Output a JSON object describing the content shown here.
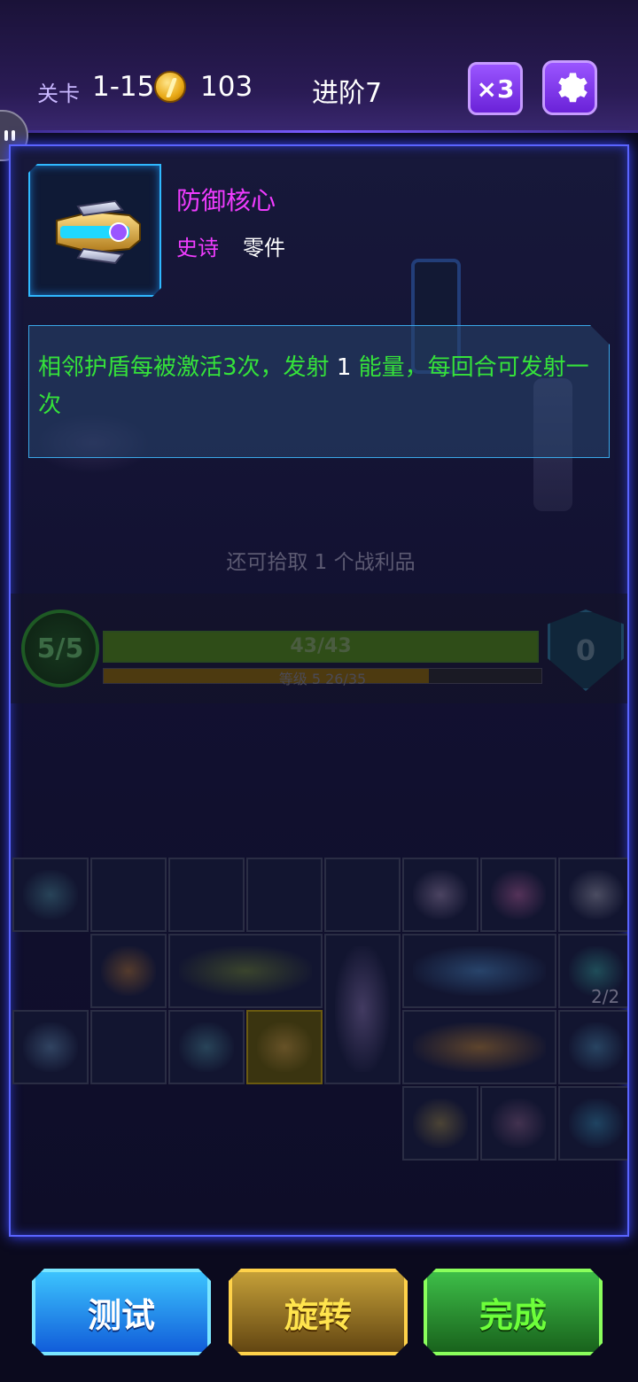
{
  "header": {
    "level_label": "关卡",
    "level_value": "1-15",
    "coins": "103",
    "stage": "进阶7",
    "multiplier": "×3"
  },
  "item": {
    "name": "防御核心",
    "rarity": "史诗",
    "type": "零件",
    "description_part1": "相邻护盾每被激活3次，发射 ",
    "description_num": "1",
    "description_part2": " 能量，每回合可发射一次"
  },
  "loot_text": "还可拾取 1 个战利品",
  "stats": {
    "hp_circle": "5/5",
    "hp_bar": "43/43",
    "hp_fraction": 1.0,
    "xp_text": "等级 5  26/35",
    "xp_fraction": 0.743,
    "shield": "0"
  },
  "grid_counter": "2/2",
  "buttons": {
    "test": "测试",
    "rotate": "旋转",
    "done": "完成"
  },
  "colors": {
    "accent_purple": "#9a55ff",
    "epic_magenta": "#f03cff",
    "description_green": "#35e23a"
  }
}
